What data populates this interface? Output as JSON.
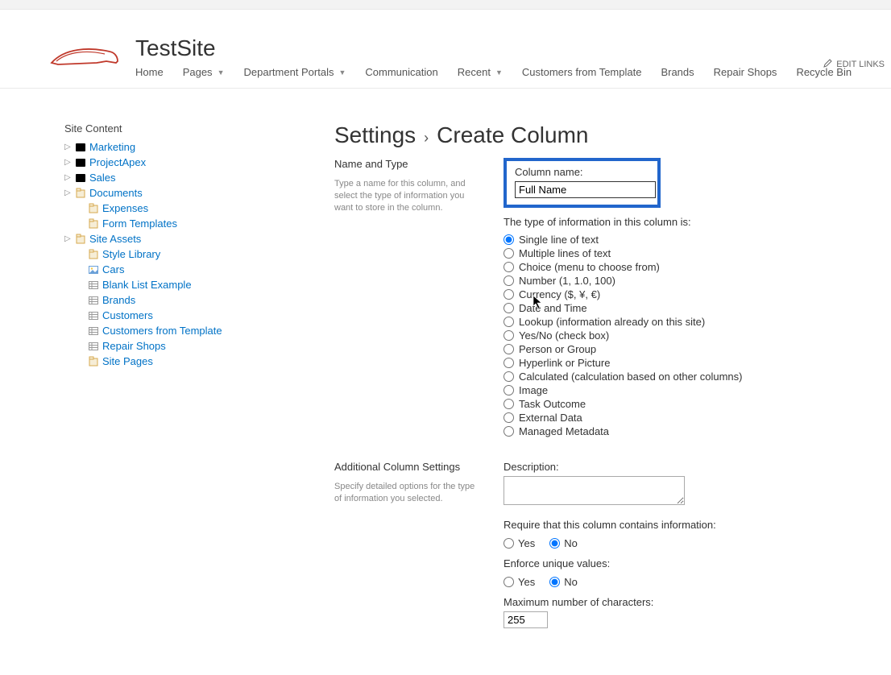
{
  "site": {
    "title": "TestSite"
  },
  "topnav": {
    "items": [
      {
        "label": "Home",
        "hasDropdown": false
      },
      {
        "label": "Pages",
        "hasDropdown": true
      },
      {
        "label": "Department Portals",
        "hasDropdown": true
      },
      {
        "label": "Communication",
        "hasDropdown": false
      },
      {
        "label": "Recent",
        "hasDropdown": true
      },
      {
        "label": "Customers from Template",
        "hasDropdown": false
      },
      {
        "label": "Brands",
        "hasDropdown": false
      },
      {
        "label": "Repair Shops",
        "hasDropdown": false
      },
      {
        "label": "Recycle Bin",
        "hasDropdown": false
      }
    ],
    "editLinks": "EDIT LINKS"
  },
  "leftnav": {
    "heading": "Site Content",
    "items": [
      {
        "label": "Marketing",
        "icon": "subsite",
        "expandable": true,
        "indent": 0
      },
      {
        "label": "ProjectApex",
        "icon": "subsite",
        "expandable": true,
        "indent": 0
      },
      {
        "label": "Sales",
        "icon": "subsite",
        "expandable": true,
        "indent": 0
      },
      {
        "label": "Documents",
        "icon": "lib",
        "expandable": true,
        "indent": 0
      },
      {
        "label": "Expenses",
        "icon": "lib",
        "expandable": false,
        "indent": 1
      },
      {
        "label": "Form Templates",
        "icon": "lib",
        "expandable": false,
        "indent": 1
      },
      {
        "label": "Site Assets",
        "icon": "lib",
        "expandable": true,
        "indent": 0
      },
      {
        "label": "Style Library",
        "icon": "lib",
        "expandable": false,
        "indent": 1
      },
      {
        "label": "Cars",
        "icon": "pic",
        "expandable": false,
        "indent": 1
      },
      {
        "label": "Blank List Example",
        "icon": "list",
        "expandable": false,
        "indent": 1
      },
      {
        "label": "Brands",
        "icon": "list",
        "expandable": false,
        "indent": 1
      },
      {
        "label": "Customers",
        "icon": "list",
        "expandable": false,
        "indent": 1
      },
      {
        "label": "Customers from Template",
        "icon": "list",
        "expandable": false,
        "indent": 1
      },
      {
        "label": "Repair Shops",
        "icon": "list",
        "expandable": false,
        "indent": 1
      },
      {
        "label": "Site Pages",
        "icon": "lib",
        "expandable": false,
        "indent": 1
      }
    ]
  },
  "page": {
    "breadcrumb1": "Settings",
    "breadcrumb2": "Create Column"
  },
  "sec1": {
    "title": "Name and Type",
    "sub": "Type a name for this column, and select the type of information you want to store in the column.",
    "colNameLabel": "Column name:",
    "colNameValue": "Full Name",
    "typePrompt": "The type of information in this column is:",
    "types": [
      "Single line of text",
      "Multiple lines of text",
      "Choice (menu to choose from)",
      "Number (1, 1.0, 100)",
      "Currency ($, ¥, €)",
      "Date and Time",
      "Lookup (information already on this site)",
      "Yes/No (check box)",
      "Person or Group",
      "Hyperlink or Picture",
      "Calculated (calculation based on other columns)",
      "Image",
      "Task Outcome",
      "External Data",
      "Managed Metadata"
    ],
    "selectedIndex": 0
  },
  "sec2": {
    "title": "Additional Column Settings",
    "sub": "Specify detailed options for the type of information you selected.",
    "descLabel": "Description:",
    "descValue": "",
    "reqLabel": "Require that this column contains information:",
    "reqYes": "Yes",
    "reqNo": "No",
    "reqSelected": "no",
    "uniqLabel": "Enforce unique values:",
    "uniqYes": "Yes",
    "uniqNo": "No",
    "uniqSelected": "no",
    "maxLabel": "Maximum number of characters:",
    "maxValue": "255"
  }
}
